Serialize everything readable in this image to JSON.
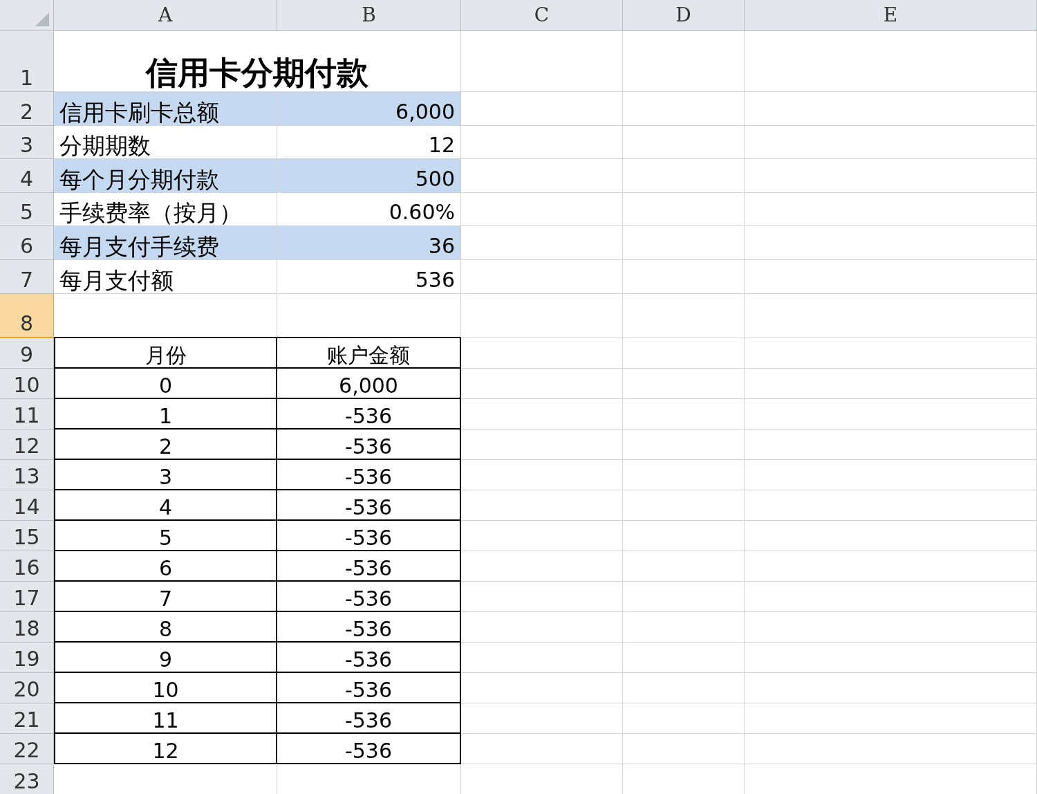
{
  "columns": [
    "A",
    "B",
    "C",
    "D",
    "E"
  ],
  "row_headers": [
    {
      "label": "1",
      "selected": false
    },
    {
      "label": "2",
      "selected": false
    },
    {
      "label": "3",
      "selected": false
    },
    {
      "label": "4",
      "selected": false
    },
    {
      "label": "5",
      "selected": false
    },
    {
      "label": "6",
      "selected": false
    },
    {
      "label": "7",
      "selected": false
    },
    {
      "label": "8",
      "selected": true
    },
    {
      "label": "9",
      "selected": false
    },
    {
      "label": "10",
      "selected": false
    },
    {
      "label": "11",
      "selected": false
    },
    {
      "label": "12",
      "selected": false
    },
    {
      "label": "13",
      "selected": false
    },
    {
      "label": "14",
      "selected": false
    },
    {
      "label": "15",
      "selected": false
    },
    {
      "label": "16",
      "selected": false
    },
    {
      "label": "17",
      "selected": false
    },
    {
      "label": "18",
      "selected": false
    },
    {
      "label": "19",
      "selected": false
    },
    {
      "label": "20",
      "selected": false
    },
    {
      "label": "21",
      "selected": false
    },
    {
      "label": "22",
      "selected": false
    },
    {
      "label": "23",
      "selected": false
    }
  ],
  "title": "信用卡分期付款",
  "summary": [
    {
      "label": "信用卡刷卡总额",
      "value": "6,000",
      "shaded": true
    },
    {
      "label": "分期期数",
      "value": "12",
      "shaded": false
    },
    {
      "label": "每个月分期付款",
      "value": "500",
      "shaded": true
    },
    {
      "label": "手续费率（按月）",
      "value": "0.60%",
      "shaded": false
    },
    {
      "label": "每月支付手续费",
      "value": "36",
      "shaded": true
    },
    {
      "label": "每月支付额",
      "value": "536",
      "shaded": false
    }
  ],
  "schedule": {
    "columns": [
      "月份",
      "账户金额"
    ],
    "rows": [
      [
        "0",
        "6,000"
      ],
      [
        "1",
        "-536"
      ],
      [
        "2",
        "-536"
      ],
      [
        "3",
        "-536"
      ],
      [
        "4",
        "-536"
      ],
      [
        "5",
        "-536"
      ],
      [
        "6",
        "-536"
      ],
      [
        "7",
        "-536"
      ],
      [
        "8",
        "-536"
      ],
      [
        "9",
        "-536"
      ],
      [
        "10",
        "-536"
      ],
      [
        "11",
        "-536"
      ],
      [
        "12",
        "-536"
      ]
    ]
  }
}
